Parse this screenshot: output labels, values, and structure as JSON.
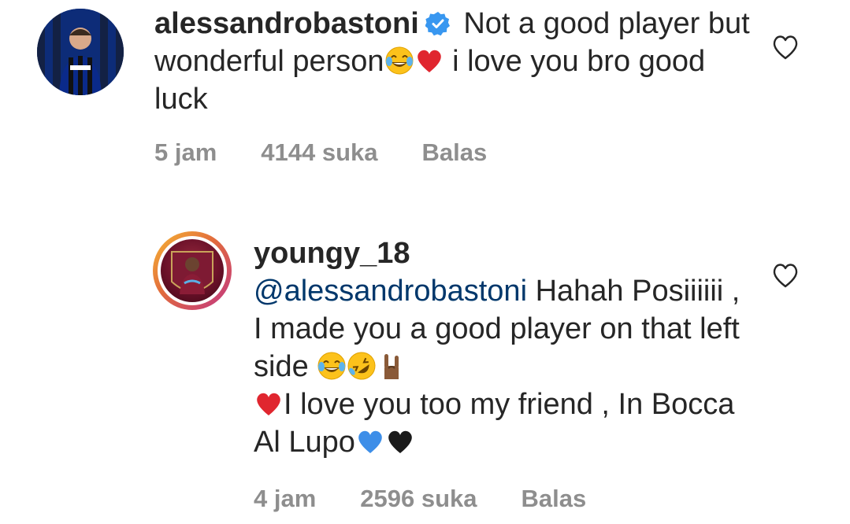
{
  "comments": [
    {
      "username": "alessandrobastoni",
      "verified": true,
      "text_1": "Not a good player but wonderful person",
      "text_2": " i love you bro good luck",
      "time": "5 jam",
      "likes": "4144 suka",
      "reply_label": "Balas",
      "avatar_icon": "inter-player-avatar"
    },
    {
      "username": "youngy_18",
      "mention": "@alessandrobastoni",
      "text_1": " Hahah Posiiiiii , I made you a good player on that left side ",
      "text_2": "I love you too my friend , In Bocca Al Lupo",
      "time": "4 jam",
      "likes": "2596 suka",
      "reply_label": "Balas",
      "avatar_icon": "aston-villa-player-avatar"
    }
  ],
  "colors": {
    "text": "#262626",
    "meta": "#8e8e8e",
    "mention": "#00376b",
    "verified": "#3897f0",
    "heart_red": "#e0262f"
  }
}
